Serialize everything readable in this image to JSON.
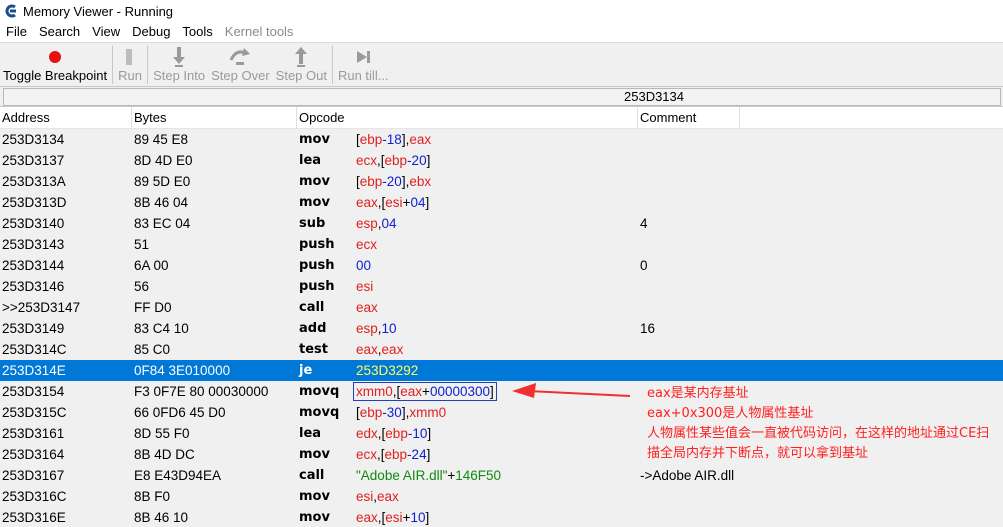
{
  "window": {
    "title": "Memory Viewer - Running"
  },
  "menu": [
    "File",
    "Search",
    "View",
    "Debug",
    "Tools",
    "Kernel tools"
  ],
  "toolbar": {
    "toggle_breakpoint": "Toggle Breakpoint",
    "run": "Run",
    "step_into": "Step Into",
    "step_over": "Step Over",
    "step_out": "Step Out",
    "run_till": "Run till..."
  },
  "address_bar": {
    "value": "253D3134"
  },
  "columns": {
    "address": "Address",
    "bytes": "Bytes",
    "opcode": "Opcode",
    "comment": "Comment"
  },
  "rows": [
    {
      "address": "253D3134",
      "bytes": "89 45 E8",
      "op": "mov",
      "args": [
        [
          "[",
          "blk"
        ],
        [
          "ebp",
          "reg"
        ],
        [
          "-18",
          "num"
        ],
        [
          "],",
          "blk"
        ],
        [
          "eax",
          "reg"
        ]
      ],
      "comment": ""
    },
    {
      "address": "253D3137",
      "bytes": "8D 4D E0",
      "op": "lea",
      "args": [
        [
          "ecx",
          "reg"
        ],
        [
          ",[",
          "blk"
        ],
        [
          "ebp",
          "reg"
        ],
        [
          "-20",
          "num"
        ],
        [
          "]",
          "blk"
        ]
      ],
      "comment": ""
    },
    {
      "address": "253D313A",
      "bytes": "89 5D E0",
      "op": "mov",
      "args": [
        [
          "[",
          "blk"
        ],
        [
          "ebp",
          "reg"
        ],
        [
          "-20",
          "num"
        ],
        [
          "],",
          "blk"
        ],
        [
          "ebx",
          "reg"
        ]
      ],
      "comment": ""
    },
    {
      "address": "253D313D",
      "bytes": "8B 46 04",
      "op": "mov",
      "args": [
        [
          "eax",
          "reg"
        ],
        [
          ",[",
          "blk"
        ],
        [
          "esi",
          "reg"
        ],
        [
          "+",
          "blk"
        ],
        [
          "04",
          "num"
        ],
        [
          "]",
          "blk"
        ]
      ],
      "comment": ""
    },
    {
      "address": "253D3140",
      "bytes": "83 EC 04",
      "op": "sub",
      "args": [
        [
          "esp",
          "reg"
        ],
        [
          ",",
          "blk"
        ],
        [
          "04",
          "num"
        ]
      ],
      "comment": "4"
    },
    {
      "address": "253D3143",
      "bytes": "51",
      "op": "push",
      "args": [
        [
          "ecx",
          "reg"
        ]
      ],
      "comment": ""
    },
    {
      "address": "253D3144",
      "bytes": "6A 00",
      "op": "push",
      "args": [
        [
          "00",
          "num"
        ]
      ],
      "comment": "0"
    },
    {
      "address": "253D3146",
      "bytes": "56",
      "op": "push",
      "args": [
        [
          "esi",
          "reg"
        ]
      ],
      "comment": ""
    },
    {
      "address": ">>253D3147",
      "bytes": "FF D0",
      "op": "call",
      "args": [
        [
          "eax",
          "reg"
        ]
      ],
      "comment": ""
    },
    {
      "address": "253D3149",
      "bytes": "83 C4 10",
      "op": "add",
      "args": [
        [
          "esp",
          "reg"
        ],
        [
          ",",
          "blk"
        ],
        [
          "10",
          "num"
        ]
      ],
      "comment": "16"
    },
    {
      "address": "253D314C",
      "bytes": "85 C0",
      "op": "test",
      "args": [
        [
          "eax",
          "reg"
        ],
        [
          ",",
          "blk"
        ],
        [
          "eax",
          "reg"
        ]
      ],
      "comment": ""
    },
    {
      "address": "253D314E",
      "bytes": "0F84 3E010000",
      "op": "je",
      "args": [
        [
          "253D3292",
          "num"
        ]
      ],
      "comment": "",
      "selected": true
    },
    {
      "address": "253D3154",
      "bytes": "F3 0F7E 80 00030000",
      "op": "movq",
      "args": [
        [
          "xmm0",
          "reg"
        ],
        [
          ",[",
          "blk"
        ],
        [
          "eax",
          "reg"
        ],
        [
          "+",
          "blk"
        ],
        [
          "00000300",
          "num"
        ],
        [
          "]",
          "blk"
        ]
      ],
      "comment": "",
      "boxed": true
    },
    {
      "address": "253D315C",
      "bytes": "66 0FD6 45 D0",
      "op": "movq",
      "args": [
        [
          "[",
          "blk"
        ],
        [
          "ebp",
          "reg"
        ],
        [
          "-30",
          "num"
        ],
        [
          "],",
          "blk"
        ],
        [
          "xmm0",
          "reg"
        ]
      ],
      "comment": ""
    },
    {
      "address": "253D3161",
      "bytes": "8D 55 F0",
      "op": "lea",
      "args": [
        [
          "edx",
          "reg"
        ],
        [
          ",[",
          "blk"
        ],
        [
          "ebp",
          "reg"
        ],
        [
          "-10",
          "num"
        ],
        [
          "]",
          "blk"
        ]
      ],
      "comment": ""
    },
    {
      "address": "253D3164",
      "bytes": "8B 4D DC",
      "op": "mov",
      "args": [
        [
          "ecx",
          "reg"
        ],
        [
          ",[",
          "blk"
        ],
        [
          "ebp",
          "reg"
        ],
        [
          "-24",
          "num"
        ],
        [
          "]",
          "blk"
        ]
      ],
      "comment": ""
    },
    {
      "address": "253D3167",
      "bytes": "E8 E43D94EA",
      "op": "call",
      "args": [
        [
          "\"Adobe AIR.dll\"",
          "sym"
        ],
        [
          "+",
          "blk"
        ],
        [
          "146F50",
          "sym"
        ]
      ],
      "comment": "->Adobe AIR.dll"
    },
    {
      "address": "253D316C",
      "bytes": "8B F0",
      "op": "mov",
      "args": [
        [
          "esi",
          "reg"
        ],
        [
          ",",
          "blk"
        ],
        [
          "eax",
          "reg"
        ]
      ],
      "comment": ""
    },
    {
      "address": "253D316E",
      "bytes": "8B 46 10",
      "op": "mov",
      "args": [
        [
          "eax",
          "reg"
        ],
        [
          ",[",
          "blk"
        ],
        [
          "esi",
          "reg"
        ],
        [
          "+",
          "blk"
        ],
        [
          "10",
          "num"
        ],
        [
          "]",
          "blk"
        ]
      ],
      "comment": ""
    }
  ],
  "annotation": {
    "lines": [
      "eax是某内存基址",
      "eax+0x300是人物属性基址",
      "人物属性某些值会一直被代码访问，在这样的地址通过CE扫",
      "描全局内存并下断点，就可以拿到基址"
    ]
  },
  "colors": {
    "selected_row": "#0078d7",
    "register": "#e02020",
    "number": "#1020d0",
    "symbol": "#108a10",
    "annotation": "#ff2020"
  }
}
